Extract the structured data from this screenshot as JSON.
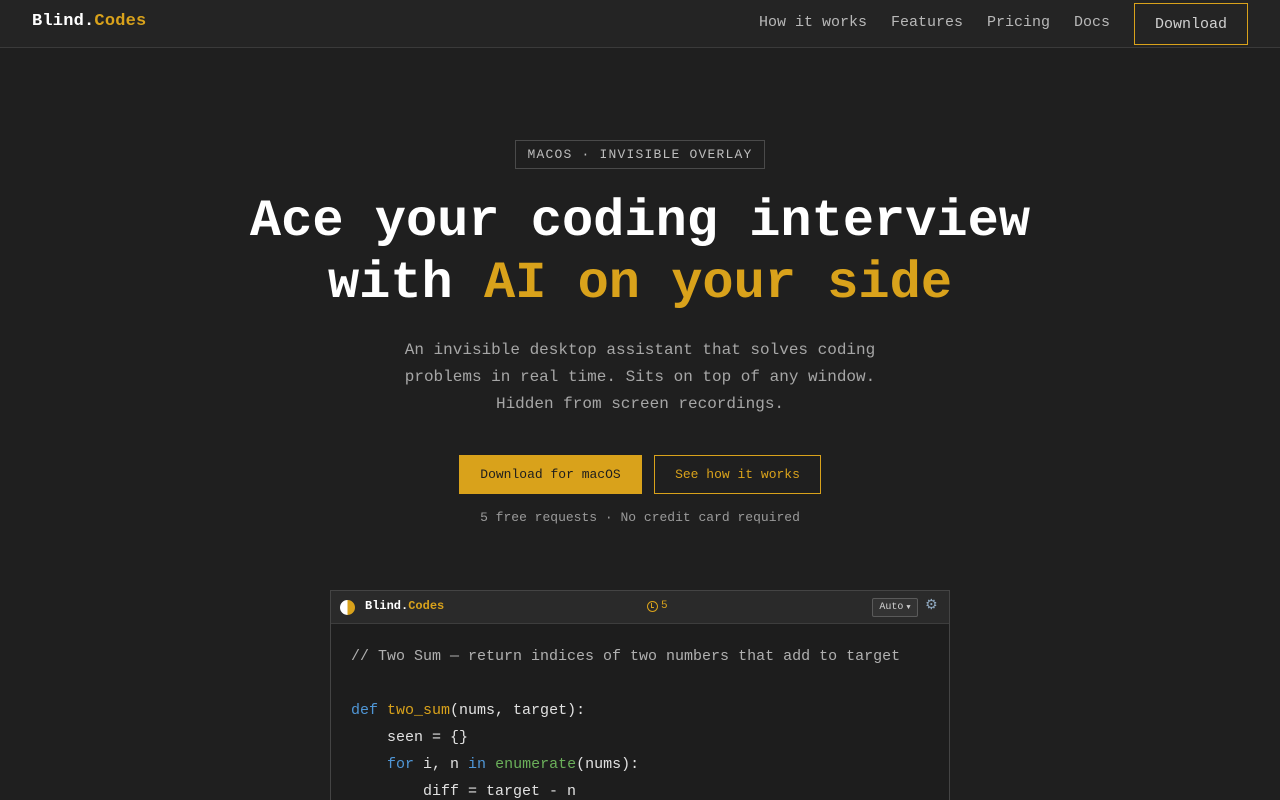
{
  "brand": {
    "name": "Blind",
    "dot": ".",
    "accent": "Codes",
    "accent_color": "#d9a21b"
  },
  "nav": {
    "links": [
      "How it works",
      "Features",
      "Pricing",
      "Docs"
    ],
    "download_label": "Download"
  },
  "hero": {
    "badge": "MACOS · INVISIBLE OVERLAY",
    "headline_line1": "Ace your coding interview",
    "headline_line2_prefix": "with ",
    "headline_line2_accent": "AI on your side",
    "subtitle_lines": [
      "An invisible desktop assistant that solves coding",
      "problems in real time. Sits on top of any window.",
      "Hidden from screen recordings."
    ],
    "primary_cta": "Download for macOS",
    "secondary_cta": "See how it works",
    "note": "5 free requests · No credit card required"
  },
  "preview": {
    "app_name": "Blind",
    "app_dot": ".",
    "app_accent": "Codes",
    "requests_count": "5",
    "mode_select": "Auto",
    "icons": [
      "half-circle-logo-icon",
      "clock-icon",
      "chevron-down-icon",
      "gear-icon"
    ],
    "code": {
      "comment": "// Two Sum — return indices of two numbers that add to target",
      "line_def_kw": "def",
      "line_def_name": "two_sum",
      "line_def_rest": "(nums, target):",
      "line_seen": "    seen = {}",
      "line_for_kw": "for",
      "line_for_mid": " i, n ",
      "line_in_kw": "in",
      "line_enum": "enumerate",
      "line_for_rest": "(nums):",
      "line_diff": "        diff = target - n"
    }
  }
}
